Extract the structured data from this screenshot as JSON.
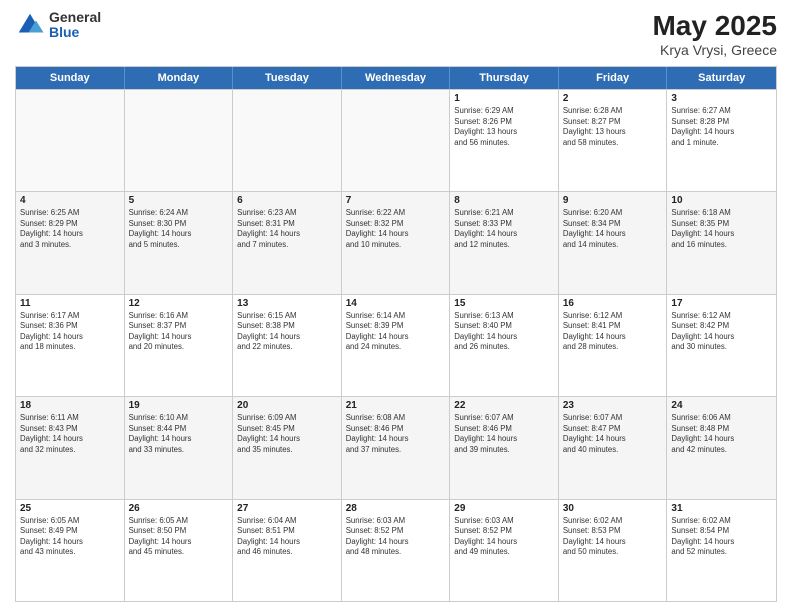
{
  "header": {
    "logo_general": "General",
    "logo_blue": "Blue",
    "title": "May 2025",
    "subtitle": "Krya Vrysi, Greece"
  },
  "weekdays": [
    "Sunday",
    "Monday",
    "Tuesday",
    "Wednesday",
    "Thursday",
    "Friday",
    "Saturday"
  ],
  "rows": [
    [
      {
        "day": "",
        "info": ""
      },
      {
        "day": "",
        "info": ""
      },
      {
        "day": "",
        "info": ""
      },
      {
        "day": "",
        "info": ""
      },
      {
        "day": "1",
        "info": "Sunrise: 6:29 AM\nSunset: 8:26 PM\nDaylight: 13 hours\nand 56 minutes."
      },
      {
        "day": "2",
        "info": "Sunrise: 6:28 AM\nSunset: 8:27 PM\nDaylight: 13 hours\nand 58 minutes."
      },
      {
        "day": "3",
        "info": "Sunrise: 6:27 AM\nSunset: 8:28 PM\nDaylight: 14 hours\nand 1 minute."
      }
    ],
    [
      {
        "day": "4",
        "info": "Sunrise: 6:25 AM\nSunset: 8:29 PM\nDaylight: 14 hours\nand 3 minutes."
      },
      {
        "day": "5",
        "info": "Sunrise: 6:24 AM\nSunset: 8:30 PM\nDaylight: 14 hours\nand 5 minutes."
      },
      {
        "day": "6",
        "info": "Sunrise: 6:23 AM\nSunset: 8:31 PM\nDaylight: 14 hours\nand 7 minutes."
      },
      {
        "day": "7",
        "info": "Sunrise: 6:22 AM\nSunset: 8:32 PM\nDaylight: 14 hours\nand 10 minutes."
      },
      {
        "day": "8",
        "info": "Sunrise: 6:21 AM\nSunset: 8:33 PM\nDaylight: 14 hours\nand 12 minutes."
      },
      {
        "day": "9",
        "info": "Sunrise: 6:20 AM\nSunset: 8:34 PM\nDaylight: 14 hours\nand 14 minutes."
      },
      {
        "day": "10",
        "info": "Sunrise: 6:18 AM\nSunset: 8:35 PM\nDaylight: 14 hours\nand 16 minutes."
      }
    ],
    [
      {
        "day": "11",
        "info": "Sunrise: 6:17 AM\nSunset: 8:36 PM\nDaylight: 14 hours\nand 18 minutes."
      },
      {
        "day": "12",
        "info": "Sunrise: 6:16 AM\nSunset: 8:37 PM\nDaylight: 14 hours\nand 20 minutes."
      },
      {
        "day": "13",
        "info": "Sunrise: 6:15 AM\nSunset: 8:38 PM\nDaylight: 14 hours\nand 22 minutes."
      },
      {
        "day": "14",
        "info": "Sunrise: 6:14 AM\nSunset: 8:39 PM\nDaylight: 14 hours\nand 24 minutes."
      },
      {
        "day": "15",
        "info": "Sunrise: 6:13 AM\nSunset: 8:40 PM\nDaylight: 14 hours\nand 26 minutes."
      },
      {
        "day": "16",
        "info": "Sunrise: 6:12 AM\nSunset: 8:41 PM\nDaylight: 14 hours\nand 28 minutes."
      },
      {
        "day": "17",
        "info": "Sunrise: 6:12 AM\nSunset: 8:42 PM\nDaylight: 14 hours\nand 30 minutes."
      }
    ],
    [
      {
        "day": "18",
        "info": "Sunrise: 6:11 AM\nSunset: 8:43 PM\nDaylight: 14 hours\nand 32 minutes."
      },
      {
        "day": "19",
        "info": "Sunrise: 6:10 AM\nSunset: 8:44 PM\nDaylight: 14 hours\nand 33 minutes."
      },
      {
        "day": "20",
        "info": "Sunrise: 6:09 AM\nSunset: 8:45 PM\nDaylight: 14 hours\nand 35 minutes."
      },
      {
        "day": "21",
        "info": "Sunrise: 6:08 AM\nSunset: 8:46 PM\nDaylight: 14 hours\nand 37 minutes."
      },
      {
        "day": "22",
        "info": "Sunrise: 6:07 AM\nSunset: 8:46 PM\nDaylight: 14 hours\nand 39 minutes."
      },
      {
        "day": "23",
        "info": "Sunrise: 6:07 AM\nSunset: 8:47 PM\nDaylight: 14 hours\nand 40 minutes."
      },
      {
        "day": "24",
        "info": "Sunrise: 6:06 AM\nSunset: 8:48 PM\nDaylight: 14 hours\nand 42 minutes."
      }
    ],
    [
      {
        "day": "25",
        "info": "Sunrise: 6:05 AM\nSunset: 8:49 PM\nDaylight: 14 hours\nand 43 minutes."
      },
      {
        "day": "26",
        "info": "Sunrise: 6:05 AM\nSunset: 8:50 PM\nDaylight: 14 hours\nand 45 minutes."
      },
      {
        "day": "27",
        "info": "Sunrise: 6:04 AM\nSunset: 8:51 PM\nDaylight: 14 hours\nand 46 minutes."
      },
      {
        "day": "28",
        "info": "Sunrise: 6:03 AM\nSunset: 8:52 PM\nDaylight: 14 hours\nand 48 minutes."
      },
      {
        "day": "29",
        "info": "Sunrise: 6:03 AM\nSunset: 8:52 PM\nDaylight: 14 hours\nand 49 minutes."
      },
      {
        "day": "30",
        "info": "Sunrise: 6:02 AM\nSunset: 8:53 PM\nDaylight: 14 hours\nand 50 minutes."
      },
      {
        "day": "31",
        "info": "Sunrise: 6:02 AM\nSunset: 8:54 PM\nDaylight: 14 hours\nand 52 minutes."
      }
    ]
  ]
}
